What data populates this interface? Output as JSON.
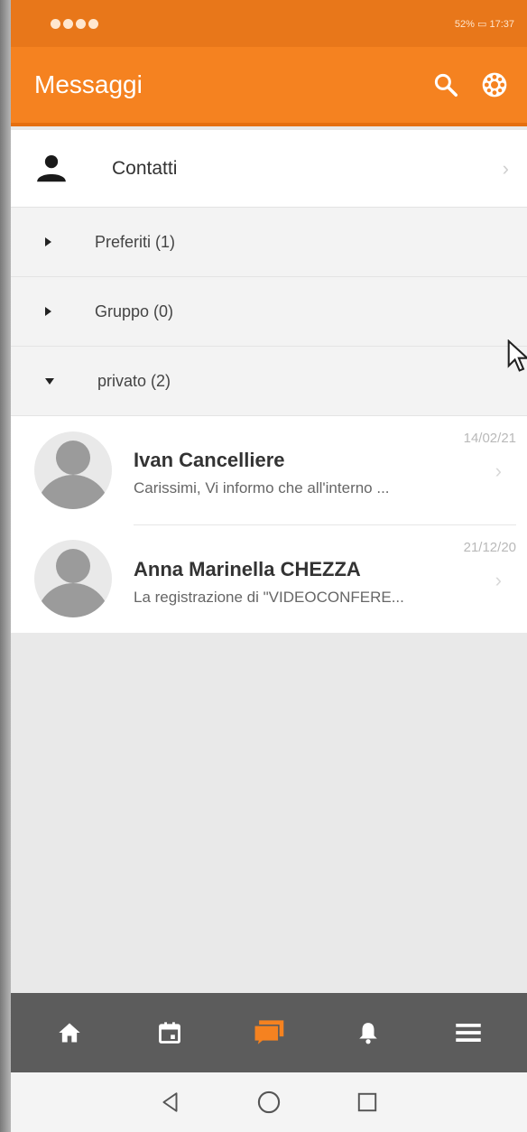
{
  "status_bar": {
    "left_text": "",
    "battery": "52%",
    "time": "17:37"
  },
  "app_bar": {
    "title": "Messaggi",
    "icons": [
      "search-icon",
      "settings-icon"
    ]
  },
  "list": {
    "contacts_label": "Contatti",
    "groups": [
      {
        "label": "Preferiti (1)",
        "expanded": false
      },
      {
        "label": "Gruppo (0)",
        "expanded": false
      },
      {
        "label": "privato (2)",
        "expanded": true
      }
    ],
    "messages": [
      {
        "name": "Ivan Cancelliere",
        "preview": "Carissimi, Vi informo che all'interno ...",
        "date": "14/02/21"
      },
      {
        "name": "Anna Marinella CHEZZA",
        "preview": "La registrazione di \"VIDEOCONFERE...",
        "date": "21/12/20"
      }
    ]
  },
  "bottom_nav": {
    "items": [
      "home-icon",
      "calendar-icon",
      "messages-icon",
      "notifications-icon",
      "menu-icon"
    ],
    "active": "messages-icon"
  },
  "colors": {
    "accent": "#f58220",
    "status_bar": "#e8771a",
    "bottom_nav": "#5c5c5c"
  }
}
